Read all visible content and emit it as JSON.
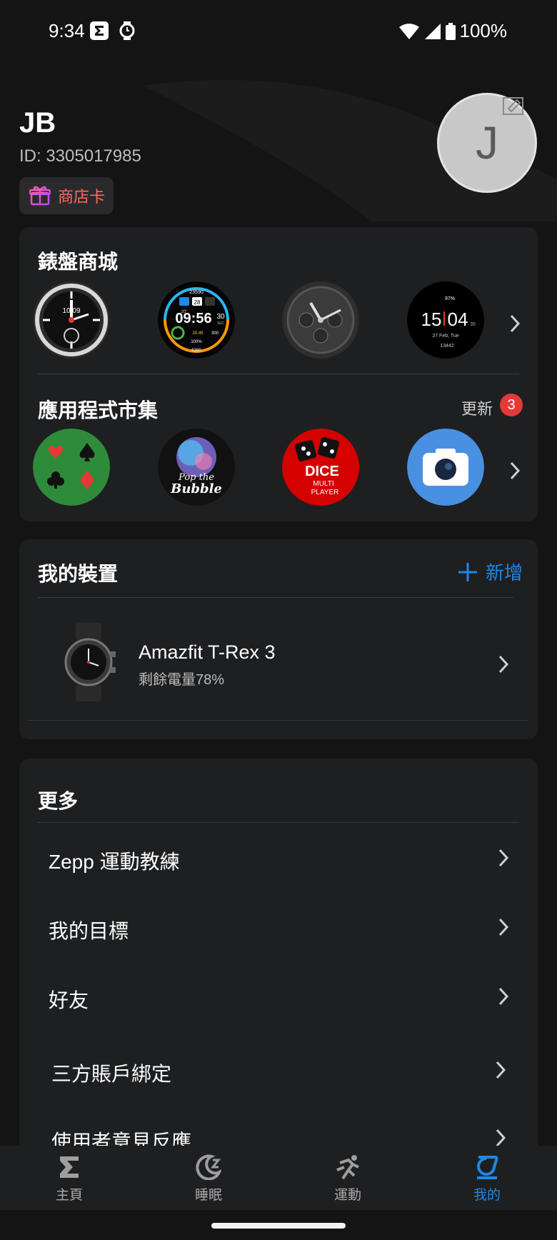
{
  "status_bar": {
    "time": "9:34",
    "battery": "100%"
  },
  "profile": {
    "name": "JB",
    "id_text": "ID: 3305017985",
    "avatar_letter": "J",
    "store_card_label": "商店卡"
  },
  "watchface_store": {
    "title": "錶盤商城",
    "faces": [
      {
        "icon": "analog-watchface-icon",
        "time": "10:09"
      },
      {
        "icon": "digital-watchface-icon",
        "time": "09:56",
        "seconds": "30",
        "sec_label": "SEC",
        "steps": "23590",
        "date": "28",
        "temp": "20°",
        "hr": "300",
        "cal": "20.45",
        "pct": "100%",
        "kcal": "5380"
      },
      {
        "icon": "chronograph-watchface-icon"
      },
      {
        "icon": "minimal-watchface-icon",
        "hour": "15",
        "minute": "04",
        "sec": "35",
        "date": "27 Feb, Tue",
        "steps": "13442",
        "batt": "97%"
      }
    ]
  },
  "app_market": {
    "title": "應用程式市集",
    "update_label": "更新",
    "update_count": "3",
    "apps": [
      {
        "icon": "card-suits-app-icon"
      },
      {
        "icon": "pop-the-bubble-app-icon",
        "line1": "Pop the",
        "line2": "Bubble"
      },
      {
        "icon": "dice-app-icon",
        "line1": "DICE",
        "line2": "MULTI",
        "line3": "PLAYER"
      },
      {
        "icon": "camera-app-icon"
      }
    ]
  },
  "devices": {
    "title": "我的裝置",
    "add_label": "新增",
    "items": [
      {
        "name": "Amazfit T-Rex 3",
        "battery": "剩餘電量78%"
      }
    ]
  },
  "more": {
    "title": "更多",
    "items": [
      {
        "label": "Zepp 運動教練"
      },
      {
        "label": "我的目標"
      },
      {
        "label": "好友"
      },
      {
        "label": "三方賬戶綁定"
      },
      {
        "label": "使用者意見反應"
      }
    ]
  },
  "bottom_nav": {
    "items": [
      {
        "label": "主頁",
        "icon": "sigma-home-icon"
      },
      {
        "label": "睡眠",
        "icon": "moon-sleep-icon"
      },
      {
        "label": "運動",
        "icon": "runner-icon"
      },
      {
        "label": "我的",
        "icon": "profile-icon",
        "active": true
      }
    ]
  },
  "colors": {
    "background": "#141414",
    "card": "#1e1f21",
    "accent": "#1e88e5",
    "badge": "#e53935",
    "store_card_text": "#ff6a5c"
  }
}
